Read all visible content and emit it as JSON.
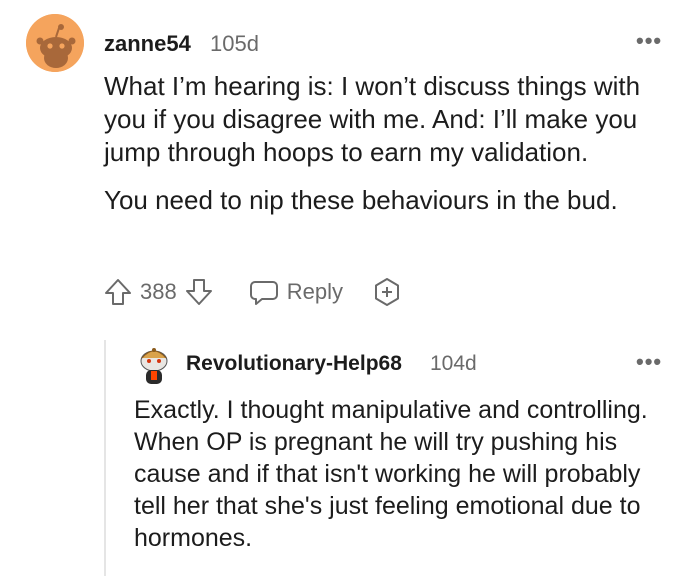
{
  "comment1": {
    "username": "zanne54",
    "age": "105d",
    "paragraphs": [
      "What I’m hearing is: I won’t discuss things with you if you disagree with me. And: I’ll make you jump through hoops to earn my validation.",
      "You need to nip these behaviours in the bud."
    ],
    "vote_count": "388",
    "reply_label": "Reply",
    "more_label": "•••"
  },
  "comment2": {
    "username": "Revolutionary-Help68",
    "age": "104d",
    "text": "Exactly. I thought manipulative and controlling. When OP is pregnant he will try pushing his cause and if that isn't working he will probably tell her that she's just feeling emotional due to hormones.",
    "more_label": "•••"
  },
  "colors": {
    "avatar1_bg": "#f5a45d",
    "text": "#1c1c1c",
    "meta": "#6a6a6a"
  }
}
